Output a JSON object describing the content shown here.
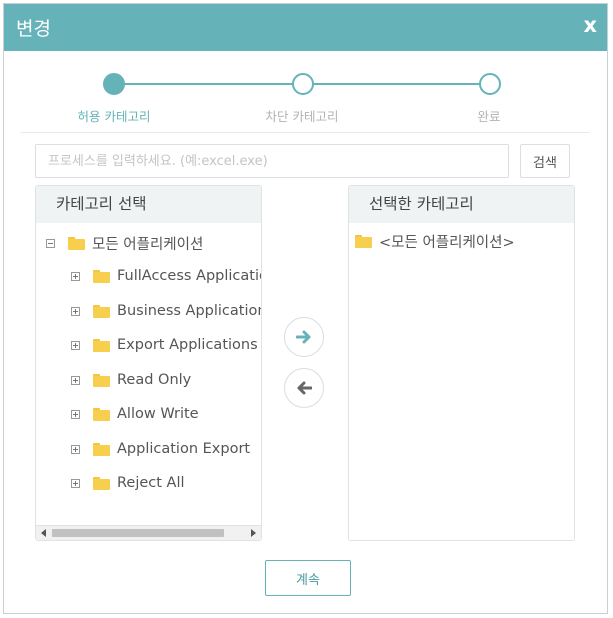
{
  "dialog": {
    "title": "변경",
    "close_label": "x"
  },
  "steps": [
    {
      "label": "허용 카테고리",
      "active": true
    },
    {
      "label": "차단 카테고리",
      "active": false
    },
    {
      "label": "완료",
      "active": false
    }
  ],
  "search": {
    "placeholder": "프로세스를 입력하세요. (예:excel.exe)",
    "value": "",
    "button_label": "검색"
  },
  "left_panel": {
    "header": "카테고리 선택",
    "root": {
      "label": "모든 어플리케이션",
      "expanded": true
    },
    "children": [
      "FullAccess Applications",
      "Business Applications",
      "Export Applications",
      "Read Only",
      "Allow Write",
      "Application Export",
      "Reject All"
    ]
  },
  "right_panel": {
    "header": "선택한 카테고리",
    "items": [
      "<모든 어플리케이션>"
    ]
  },
  "buttons": {
    "add_icon": "arrow-right-icon",
    "remove_icon": "arrow-left-icon",
    "continue_label": "계속"
  },
  "colors": {
    "accent": "#65b3b9",
    "folder": "#f7cf4d",
    "panel_header": "#f0f3f4"
  }
}
